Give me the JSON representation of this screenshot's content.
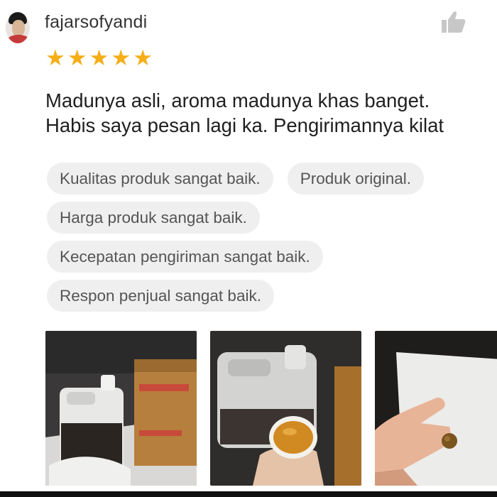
{
  "review": {
    "username": "fajarsofyandi",
    "rating": 5,
    "comment_lines": [
      "Madunya asli, aroma madunya khas banget.",
      "Habis saya pesan lagi ka. Pengirimannya kilat"
    ],
    "tags": [
      "Kualitas produk sangat baik.",
      "Produk original.",
      "Harga produk sangat baik.",
      "Kecepatan pengiriman sangat baik.",
      "Respon penjual sangat baik."
    ],
    "photos": [
      "review-photo-1",
      "review-photo-2",
      "review-photo-3"
    ]
  },
  "icons": {
    "like": "thumbs-up-icon",
    "star": "star-icon",
    "avatar": "avatar"
  },
  "colors": {
    "star": "#f5ae18",
    "tag_background": "#efefef",
    "tag_text": "#555555"
  }
}
